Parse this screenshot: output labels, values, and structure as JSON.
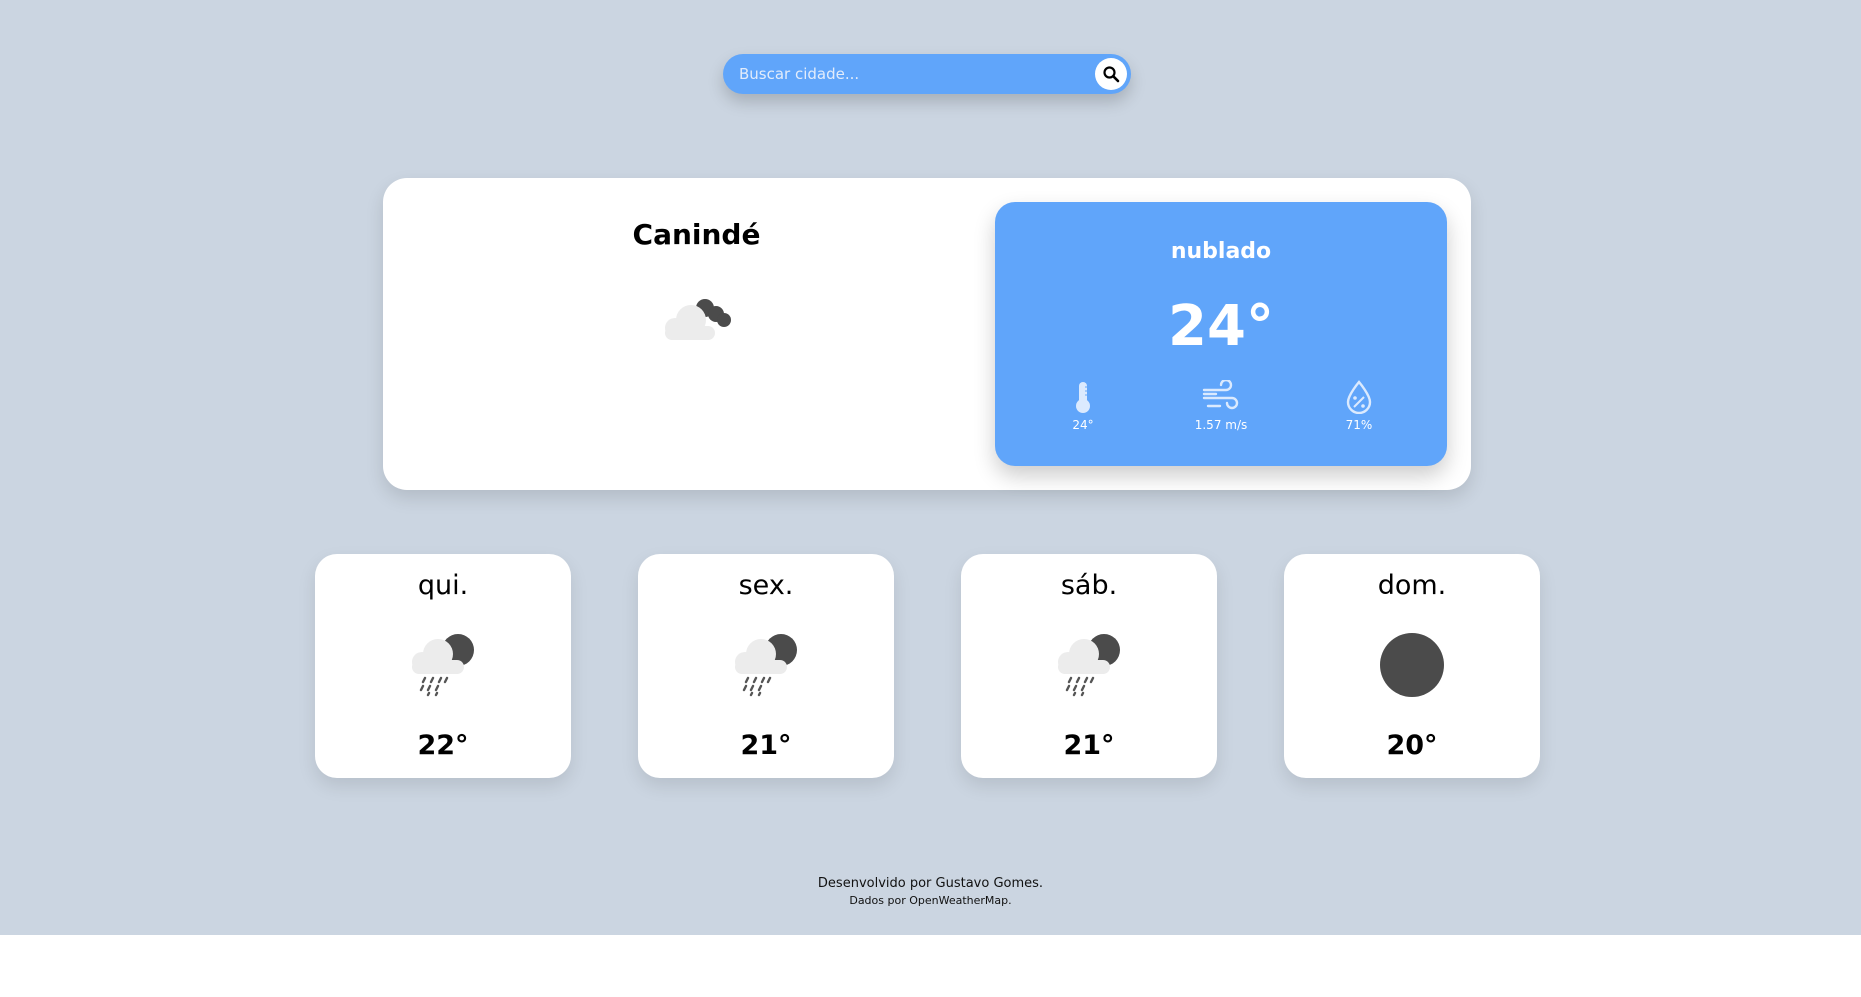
{
  "search": {
    "placeholder": "Buscar cidade...",
    "button_icon": "search-icon"
  },
  "current": {
    "city": "Canindé",
    "icon": "cloudy-night-icon",
    "description": "nublado",
    "temperature": "24°",
    "stats": [
      {
        "icon": "thermometer-icon",
        "value": "24°"
      },
      {
        "icon": "wind-icon",
        "value": "1.57 m/s"
      },
      {
        "icon": "humidity-icon",
        "value": "71%"
      }
    ]
  },
  "forecast": [
    {
      "day": "qui.",
      "icon": "rain-night-icon",
      "temp": "22°"
    },
    {
      "day": "sex.",
      "icon": "rain-night-icon",
      "temp": "21°"
    },
    {
      "day": "sáb.",
      "icon": "rain-night-icon",
      "temp": "21°"
    },
    {
      "day": "dom.",
      "icon": "moon-icon",
      "temp": "20°"
    }
  ],
  "footer": {
    "line1": "Desenvolvido por Gustavo Gomes.",
    "line2": "Dados por OpenWeatherMap."
  },
  "colors": {
    "background": "#cbd5e1",
    "accent": "#60a5fa",
    "card": "#ffffff"
  }
}
